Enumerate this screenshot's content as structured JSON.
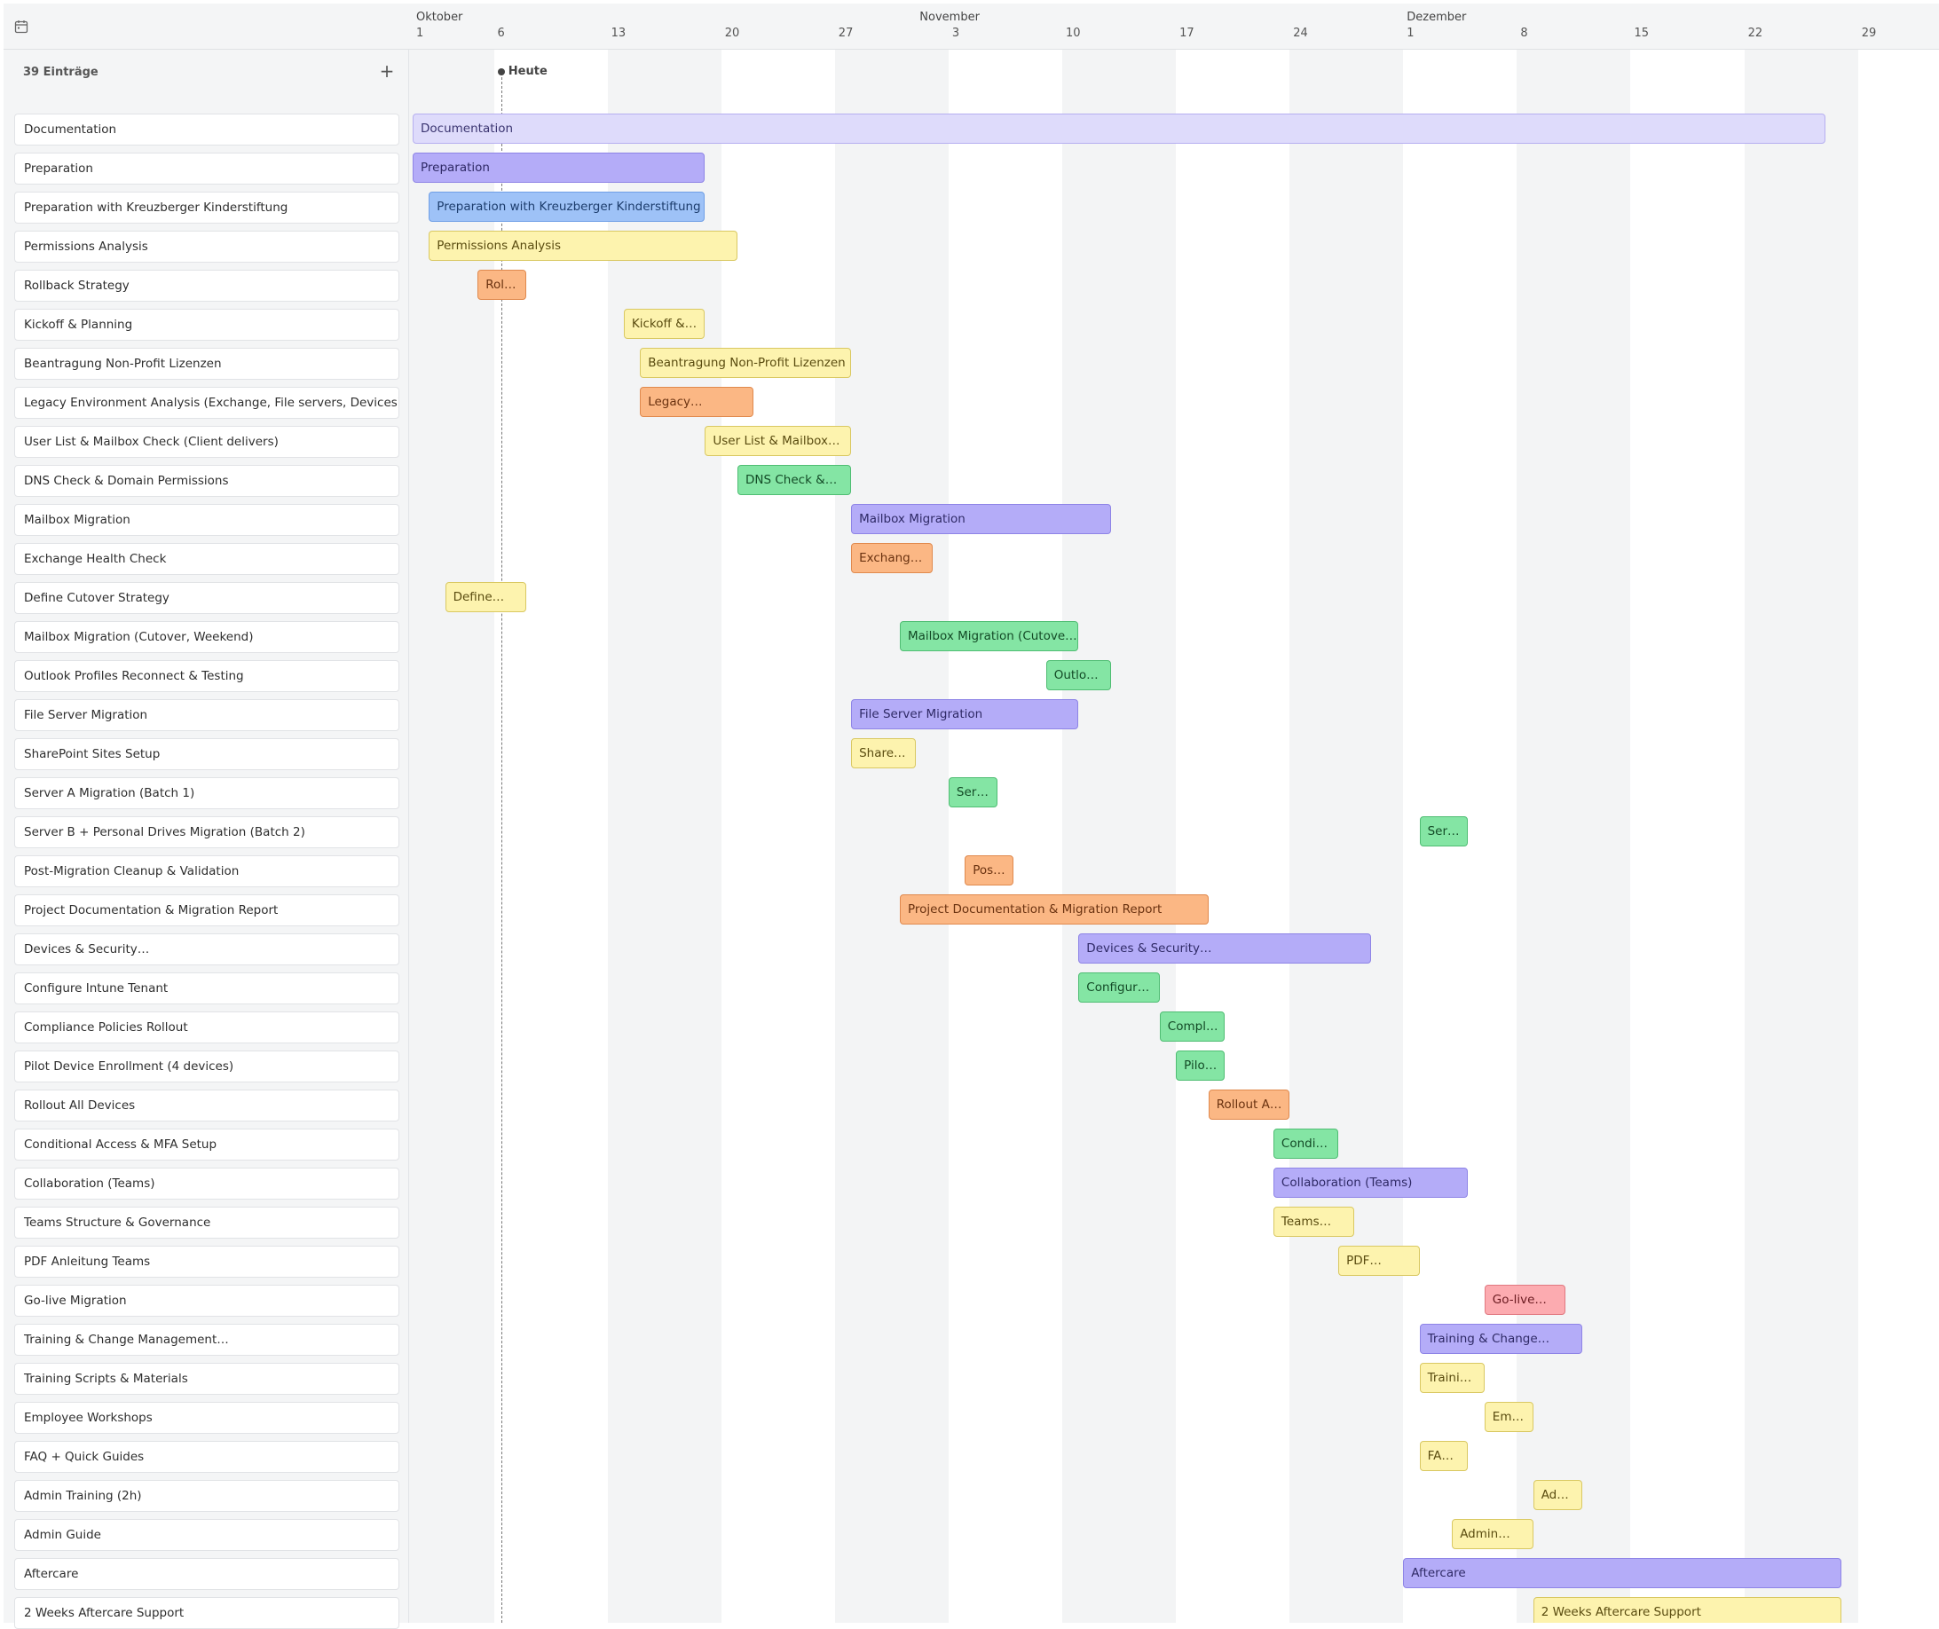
{
  "header": {
    "calendar_icon": "calendar-icon",
    "months": [
      {
        "label": "Oktober",
        "day": 0
      },
      {
        "label": "November",
        "day": 31
      },
      {
        "label": "Dezember",
        "day": 61
      }
    ],
    "ticks": [
      {
        "label": "1",
        "day": 0
      },
      {
        "label": "6",
        "day": 5
      },
      {
        "label": "13",
        "day": 12
      },
      {
        "label": "20",
        "day": 19
      },
      {
        "label": "27",
        "day": 26
      },
      {
        "label": "3",
        "day": 33
      },
      {
        "label": "10",
        "day": 40
      },
      {
        "label": "17",
        "day": 47
      },
      {
        "label": "24",
        "day": 54
      },
      {
        "label": "1",
        "day": 61
      },
      {
        "label": "8",
        "day": 68
      },
      {
        "label": "15",
        "day": 75
      },
      {
        "label": "22",
        "day": 82
      },
      {
        "label": "29",
        "day": 89
      }
    ]
  },
  "sidebar": {
    "entries_count": "39 Einträge",
    "add_icon": "+"
  },
  "today": {
    "label": "Heute",
    "day": 6
  },
  "colors": {
    "purple": {
      "bg": "#b4acf8",
      "border": "#8e84e6",
      "text": "#2f2a66"
    },
    "lavender": {
      "bg": "#dedbfb",
      "border": "#b6aff0",
      "text": "#3a3470"
    },
    "blue": {
      "bg": "#9ec2f7",
      "border": "#6f9fe6",
      "text": "#1d3d6d"
    },
    "yellow": {
      "bg": "#fdf3ae",
      "border": "#d9c862",
      "text": "#5a4c10"
    },
    "orange": {
      "bg": "#fbb784",
      "border": "#e0894d",
      "text": "#6a3210"
    },
    "green": {
      "bg": "#84e5a4",
      "border": "#4fbd73",
      "text": "#134a26"
    },
    "red": {
      "bg": "#fcabb0",
      "border": "#e17880",
      "text": "#6a1a20"
    }
  },
  "tasks": [
    {
      "label": "Documentation",
      "bar_label": "Documentation",
      "start": 0,
      "end": 87,
      "color": "lavender"
    },
    {
      "label": "Preparation",
      "bar_label": "Preparation",
      "start": 0,
      "end": 18,
      "color": "purple"
    },
    {
      "label": "Preparation with Kreuzberger Kinderstiftung",
      "bar_label": "Preparation with Kreuzberger Kinderstiftung",
      "start": 1,
      "end": 18,
      "color": "blue"
    },
    {
      "label": "Permissions Analysis",
      "bar_label": "Permissions Analysis",
      "start": 1,
      "end": 20,
      "color": "yellow"
    },
    {
      "label": "Rollback Strategy",
      "bar_label": "Rol…",
      "start": 4,
      "end": 7,
      "color": "orange"
    },
    {
      "label": "Kickoff & Planning",
      "bar_label": "Kickoff &…",
      "start": 13,
      "end": 18,
      "color": "yellow"
    },
    {
      "label": "Beantragung Non-Profit Lizenzen",
      "bar_label": "Beantragung Non-Profit Lizenzen",
      "start": 14,
      "end": 27,
      "color": "yellow"
    },
    {
      "label": "Legacy Environment Analysis (Exchange, File servers, Devices)",
      "bar_label": "Legacy…",
      "start": 14,
      "end": 21,
      "color": "orange"
    },
    {
      "label": "User List & Mailbox Check (Client delivers)",
      "bar_label": "User List & Mailbox…",
      "start": 18,
      "end": 27,
      "color": "yellow"
    },
    {
      "label": "DNS Check & Domain Permissions",
      "bar_label": "DNS Check &…",
      "start": 20,
      "end": 27,
      "color": "green"
    },
    {
      "label": "Mailbox Migration",
      "bar_label": "Mailbox Migration",
      "start": 27,
      "end": 43,
      "color": "purple"
    },
    {
      "label": "Exchange Health Check",
      "bar_label": "Exchang…",
      "start": 27,
      "end": 32,
      "color": "orange"
    },
    {
      "label": "Define Cutover Strategy",
      "bar_label": "Define…",
      "start": 2,
      "end": 7,
      "color": "yellow"
    },
    {
      "label": "Mailbox Migration (Cutover, Weekend)",
      "bar_label": "Mailbox Migration (Cutove…",
      "start": 30,
      "end": 41,
      "color": "green"
    },
    {
      "label": "Outlook Profiles Reconnect & Testing",
      "bar_label": "Outlo…",
      "start": 39,
      "end": 43,
      "color": "green"
    },
    {
      "label": "File Server Migration",
      "bar_label": "File Server Migration",
      "start": 27,
      "end": 41,
      "color": "purple"
    },
    {
      "label": "SharePoint Sites Setup",
      "bar_label": "Share…",
      "start": 27,
      "end": 31,
      "color": "yellow"
    },
    {
      "label": "Server A Migration (Batch 1)",
      "bar_label": "Ser…",
      "start": 33,
      "end": 36,
      "color": "green"
    },
    {
      "label": "Server B + Personal Drives Migration (Batch 2)",
      "bar_label": "Ser…",
      "start": 62,
      "end": 65,
      "color": "green"
    },
    {
      "label": "Post-Migration Cleanup & Validation",
      "bar_label": "Pos…",
      "start": 34,
      "end": 37,
      "color": "orange"
    },
    {
      "label": "Project Documentation & Migration Report",
      "bar_label": "Project Documentation & Migration Report",
      "start": 30,
      "end": 49,
      "color": "orange"
    },
    {
      "label": "Devices & Security…",
      "bar_label": "Devices & Security…",
      "start": 41,
      "end": 59,
      "color": "purple"
    },
    {
      "label": "Configure Intune Tenant",
      "bar_label": "Configur…",
      "start": 41,
      "end": 46,
      "color": "green"
    },
    {
      "label": "Compliance Policies Rollout",
      "bar_label": "Compl…",
      "start": 46,
      "end": 50,
      "color": "green"
    },
    {
      "label": "Pilot Device Enrollment (4 devices)",
      "bar_label": "Pilo…",
      "start": 47,
      "end": 50,
      "color": "green"
    },
    {
      "label": "Rollout All Devices",
      "bar_label": "Rollout A…",
      "start": 49,
      "end": 54,
      "color": "orange"
    },
    {
      "label": "Conditional Access & MFA Setup",
      "bar_label": "Condi…",
      "start": 53,
      "end": 57,
      "color": "green"
    },
    {
      "label": "Collaboration (Teams)",
      "bar_label": "Collaboration (Teams)",
      "start": 53,
      "end": 65,
      "color": "purple"
    },
    {
      "label": "Teams Structure & Governance",
      "bar_label": "Teams…",
      "start": 53,
      "end": 58,
      "color": "yellow"
    },
    {
      "label": "PDF Anleitung Teams",
      "bar_label": "PDF…",
      "start": 57,
      "end": 62,
      "color": "yellow"
    },
    {
      "label": "Go-live Migration",
      "bar_label": "Go-live…",
      "start": 66,
      "end": 71,
      "color": "red"
    },
    {
      "label": "Training & Change Management…",
      "bar_label": "Training & Change…",
      "start": 62,
      "end": 72,
      "color": "purple"
    },
    {
      "label": "Training Scripts & Materials",
      "bar_label": "Traini…",
      "start": 62,
      "end": 66,
      "color": "yellow"
    },
    {
      "label": "Employee Workshops",
      "bar_label": "Em…",
      "start": 66,
      "end": 69,
      "color": "yellow"
    },
    {
      "label": "FAQ + Quick Guides",
      "bar_label": "FA…",
      "start": 62,
      "end": 65,
      "color": "yellow"
    },
    {
      "label": "Admin Training (2h)",
      "bar_label": "Ad…",
      "start": 69,
      "end": 72,
      "color": "yellow"
    },
    {
      "label": "Admin Guide",
      "bar_label": "Admin…",
      "start": 64,
      "end": 69,
      "color": "yellow"
    },
    {
      "label": "Aftercare",
      "bar_label": "Aftercare",
      "start": 61,
      "end": 88,
      "color": "purple"
    },
    {
      "label": "2 Weeks Aftercare Support",
      "bar_label": "2 Weeks Aftercare Support",
      "start": 69,
      "end": 88,
      "color": "yellow"
    }
  ]
}
